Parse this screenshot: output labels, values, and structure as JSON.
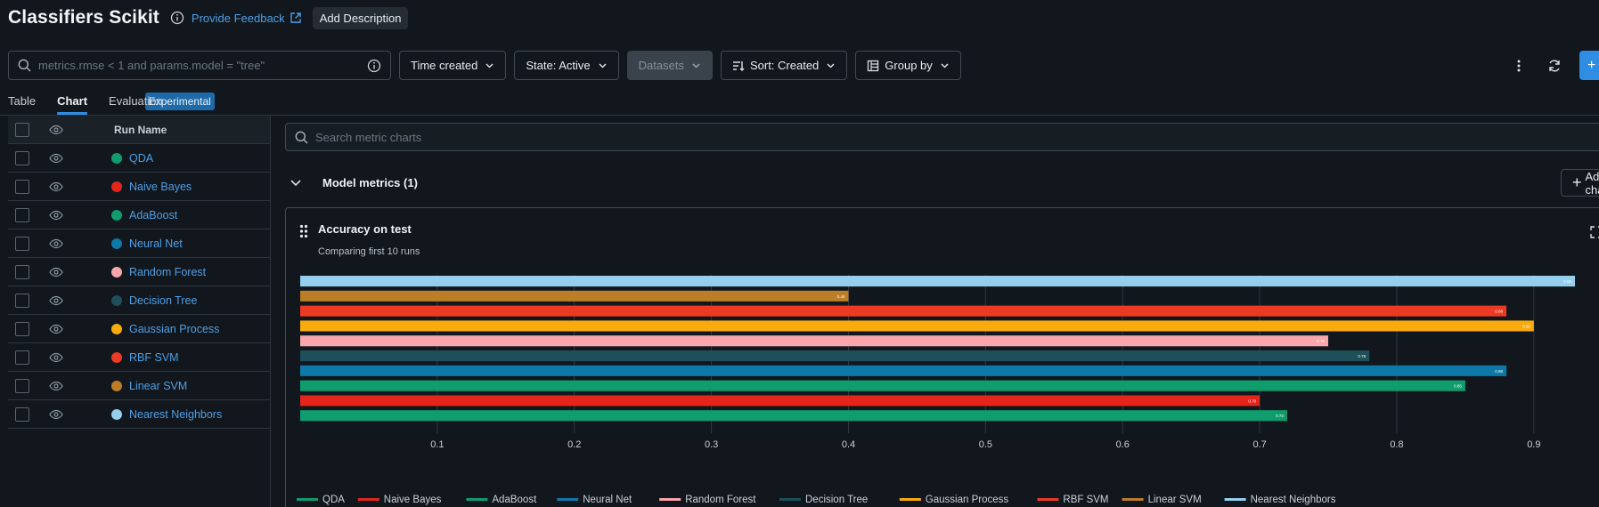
{
  "header": {
    "title": "Classifiers Scikit",
    "feedback_label": "Provide Feedback",
    "add_description_label": "Add Description"
  },
  "toolbar": {
    "search_placeholder": "metrics.rmse < 1 and params.model = \"tree\"",
    "time_created_label": "Time created",
    "state_label": "State: Active",
    "datasets_label": "Datasets",
    "sort_label": "Sort: Created",
    "group_by_label": "Group by",
    "new_run_label": "+"
  },
  "tabs": {
    "table": "Table",
    "chart": "Chart",
    "evaluation": "Evaluation",
    "experimental": "Experimental"
  },
  "run_list": {
    "header": "Run Name",
    "runs": [
      {
        "name": "QDA",
        "color": "#0f9d6e"
      },
      {
        "name": "Naive Bayes",
        "color": "#e3251b"
      },
      {
        "name": "AdaBoost",
        "color": "#0f9d6e"
      },
      {
        "name": "Neural Net",
        "color": "#0e78a8"
      },
      {
        "name": "Random Forest",
        "color": "#f9a6ac"
      },
      {
        "name": "Decision Tree",
        "color": "#1f4f59"
      },
      {
        "name": "Gaussian Process",
        "color": "#f9ab0e"
      },
      {
        "name": "RBF SVM",
        "color": "#ec3a24"
      },
      {
        "name": "Linear SVM",
        "color": "#bb7d26"
      },
      {
        "name": "Nearest Neighbors",
        "color": "#96cfee"
      }
    ]
  },
  "charts": {
    "search_placeholder": "Search metric charts",
    "section_title": "Model metrics (1)",
    "add_chart_label": "Add chart",
    "card_title": "Accuracy on test",
    "card_subtitle": "Comparing first 10 runs"
  },
  "chart_data": {
    "type": "bar",
    "orientation": "horizontal",
    "categories": [
      "Nearest Neighbors",
      "Linear SVM",
      "RBF SVM",
      "Gaussian Process",
      "Random Forest",
      "Decision Tree",
      "Neural Net",
      "AdaBoost",
      "Naive Bayes",
      "QDA"
    ],
    "values": [
      0.93,
      0.4,
      0.88,
      0.9,
      0.75,
      0.78,
      0.88,
      0.85,
      0.7,
      0.72
    ],
    "value_labels": [
      "0.93",
      "0.40",
      "0.88",
      "0.90",
      "0.75",
      "0.78",
      "0.88",
      "0.85",
      "0.70",
      "0.72"
    ],
    "bar_order_top_to_bottom": [
      "Nearest Neighbors",
      "Linear SVM",
      "RBF SVM",
      "Gaussian Process",
      "Random Forest",
      "Decision Tree",
      "Neural Net",
      "AdaBoost",
      "Naive Bayes",
      "QDA"
    ],
    "x_ticks": [
      "0.1",
      "0.2",
      "0.3",
      "0.4",
      "0.5",
      "0.6",
      "0.7",
      "0.8",
      "0.9"
    ],
    "xlim": [
      0,
      0.93
    ],
    "grid": true,
    "legend_position": "bottom",
    "legend": [
      {
        "name": "QDA",
        "color": "#0f9d6e"
      },
      {
        "name": "Naive Bayes",
        "color": "#e3251b"
      },
      {
        "name": "AdaBoost",
        "color": "#0f9d6e"
      },
      {
        "name": "Neural Net",
        "color": "#0e78a8"
      },
      {
        "name": "Random Forest",
        "color": "#f9a6ac"
      },
      {
        "name": "Decision Tree",
        "color": "#1f4f59"
      },
      {
        "name": "Gaussian Process",
        "color": "#f9ab0e"
      },
      {
        "name": "RBF SVM",
        "color": "#ec3a24"
      },
      {
        "name": "Linear SVM",
        "color": "#bb7d26"
      },
      {
        "name": "Nearest Neighbors",
        "color": "#96cfee"
      }
    ]
  }
}
